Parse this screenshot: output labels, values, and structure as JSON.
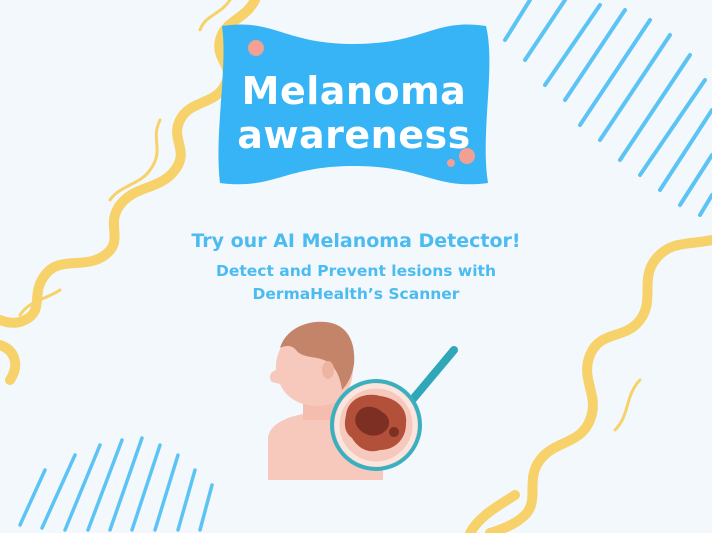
{
  "badge": {
    "title_line1": "Melanoma",
    "title_line2": "awareness",
    "color": "#36b4f5",
    "dot_color": "#f2a093"
  },
  "headline": "Try our AI Melanoma Detector!",
  "subline": {
    "line1": "Detect and Prevent lesions with",
    "line2": "DermaHealth’s Scanner"
  },
  "illustration": {
    "icon": "skin-scanner-illustration"
  },
  "colors": {
    "background": "#f3f8fc",
    "text_accent": "#4bbbf0",
    "wave_yellow": "#f7d26a",
    "stripe_blue": "#5cc4f4"
  }
}
